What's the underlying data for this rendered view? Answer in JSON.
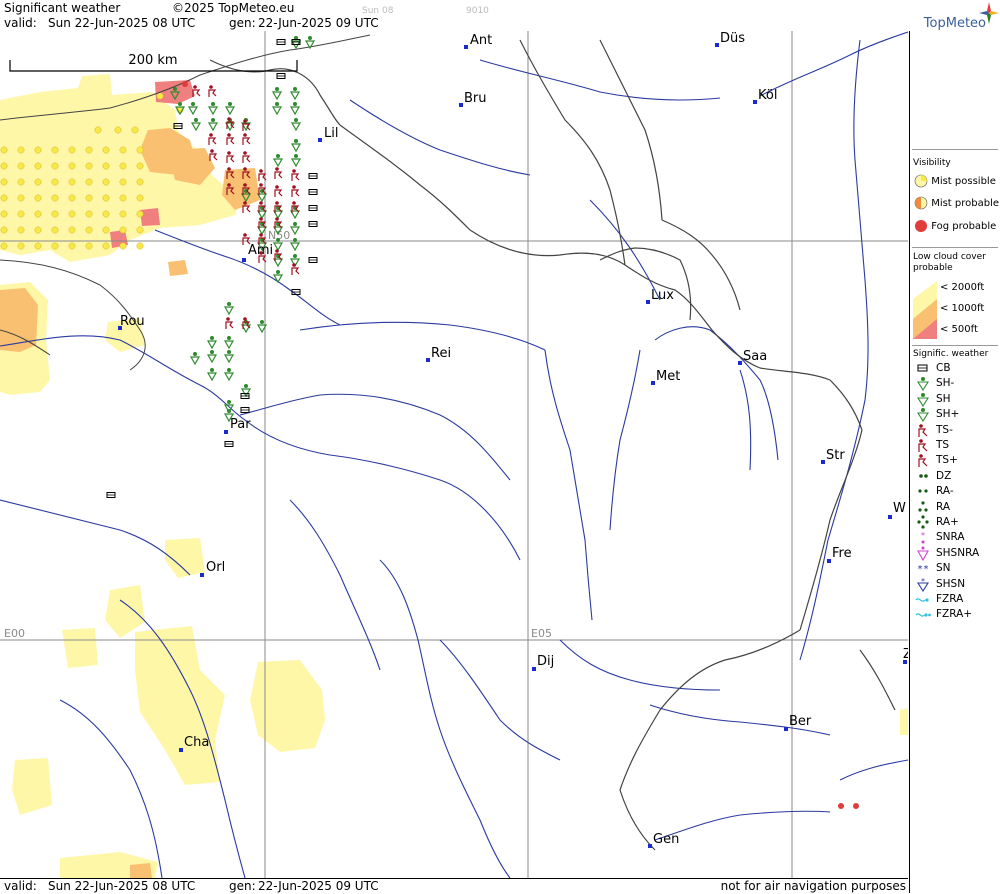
{
  "header": {
    "title": "Significant weather",
    "copyright": "©2025 TopMeteo.eu",
    "valid_label": "valid:",
    "valid_date": "Sun  22-Jun-2025  08 UTC",
    "gen_label": "gen:",
    "gen_date": "22-Jun-2025 09 UTC",
    "tab_hint": "Sun 08",
    "tab_code": "9010"
  },
  "logo": {
    "text": "TopMeteo"
  },
  "footer": {
    "valid_label": "valid:",
    "valid_date": "Sun  22-Jun-2025  08 UTC",
    "gen_label": "gen:",
    "gen_date": "22-Jun-2025 09 UTC",
    "disclaimer": "not for air navigation purposes"
  },
  "map": {
    "scale_label": "200 km",
    "grid_labels": {
      "lat": "N50",
      "lon0": "E00",
      "lon5": "E05"
    },
    "cities": [
      {
        "label": "Ant"
      },
      {
        "label": "Düs"
      },
      {
        "label": "Bru"
      },
      {
        "label": "Köl"
      },
      {
        "label": "Lil"
      },
      {
        "label": "Ami"
      },
      {
        "label": "Rou"
      },
      {
        "label": "Lux"
      },
      {
        "label": "Rei"
      },
      {
        "label": "Met"
      },
      {
        "label": "Saa"
      },
      {
        "label": "Par"
      },
      {
        "label": "Str"
      },
      {
        "label": "W"
      },
      {
        "label": "Fre"
      },
      {
        "label": "Orl"
      },
      {
        "label": "Dij"
      },
      {
        "label": "Ber"
      },
      {
        "label": "Cha"
      },
      {
        "label": "Gen"
      },
      {
        "label": "Z"
      }
    ],
    "colors": {
      "mist": "#f8e84a",
      "mist_probable": "#f08a3c",
      "fog": "#e23b3b",
      "cloud_2000": "#fff7a8",
      "cloud_1000": "#f8c070",
      "cloud_500": "#f07f7f",
      "rivers": "#2a3aa0",
      "borders": "#444444",
      "grid": "#8a8a8a",
      "shower": "#2e8b2e",
      "thunder": "#a01020"
    }
  },
  "legend": {
    "visibility_title": "Visibility",
    "visibility": [
      {
        "label": "Mist possible",
        "icon": "mist-possible-icon"
      },
      {
        "label": "Mist probable",
        "icon": "mist-probable-icon"
      },
      {
        "label": "Fog probable",
        "icon": "fog-probable-icon"
      }
    ],
    "lowcloud_title_1": "Low cloud cover",
    "lowcloud_title_2": "probable",
    "lowcloud": [
      {
        "label": "< 2000ft"
      },
      {
        "label": "< 1000ft"
      },
      {
        "label": "<   500ft"
      }
    ],
    "sigwx_title": "Signific. weather",
    "sigwx": [
      {
        "label": "CB",
        "icon": "cb-icon"
      },
      {
        "label": "SH-",
        "icon": "shower-light-icon"
      },
      {
        "label": "SH",
        "icon": "shower-icon"
      },
      {
        "label": "SH+",
        "icon": "shower-heavy-icon"
      },
      {
        "label": "TS-",
        "icon": "thunderstorm-light-icon"
      },
      {
        "label": "TS",
        "icon": "thunderstorm-icon"
      },
      {
        "label": "TS+",
        "icon": "thunderstorm-heavy-icon"
      },
      {
        "label": "DZ",
        "icon": "drizzle-icon"
      },
      {
        "label": "RA-",
        "icon": "rain-light-icon"
      },
      {
        "label": "RA",
        "icon": "rain-icon"
      },
      {
        "label": "RA+",
        "icon": "rain-heavy-icon"
      },
      {
        "label": "SNRA",
        "icon": "snow-rain-icon"
      },
      {
        "label": "SHSNRA",
        "icon": "shower-snow-rain-icon"
      },
      {
        "label": "SN",
        "icon": "snow-icon"
      },
      {
        "label": "SHSN",
        "icon": "snow-shower-icon"
      },
      {
        "label": "FZRA",
        "icon": "freezing-rain-icon"
      },
      {
        "label": "FZRA+",
        "icon": "freezing-rain-heavy-icon"
      }
    ]
  }
}
